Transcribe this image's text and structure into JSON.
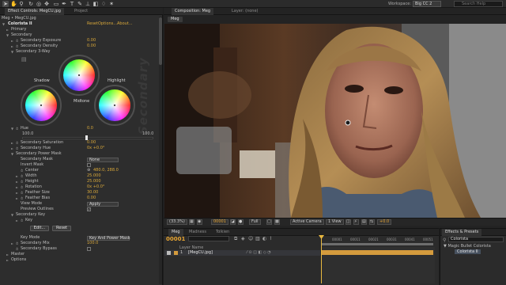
{
  "toolbar": {
    "tools": [
      "selection-tool",
      "hand-tool",
      "zoom-tool",
      "rotation-tool",
      "camera-orbit-tool",
      "pan-behind-tool",
      "rectangle-mask-tool",
      "pen-tool",
      "type-tool",
      "brush-tool",
      "clone-stamp-tool",
      "eraser-tool",
      "roto-brush-tool",
      "puppet-pin-tool"
    ],
    "workspace_label": "Workspace:",
    "workspace_value": "Big CC 2",
    "help_placeholder": "Search Help"
  },
  "effects_panel": {
    "tab_label": "Effect Controls: MegCU.jpg",
    "project_tab": "Project",
    "breadcrumb": "Meg • MegCU.jpg",
    "effect_name": "Colorista II",
    "effect_links": [
      "Reset",
      "Options...",
      "About..."
    ],
    "rows": {
      "primary": "Primary",
      "secondary": "Secondary",
      "sec_exposure": "Secondary Exposure",
      "sec_exposure_val": "0.00",
      "sec_density": "Secondary Density",
      "sec_density_val": "0.00",
      "sec_3way": "Secondary 3-Way",
      "hue": "Hue",
      "hue_val": "0.0",
      "hue_range_min": "100.0",
      "hue_range_max": "100.0",
      "sec_saturation": "Secondary Saturation",
      "sec_saturation_val": "0.00",
      "sec_hue": "Secondary Hue",
      "sec_hue_val": "0x +0.0°",
      "sec_power_mask": "Secondary Power Mask",
      "sec_mask": "Secondary Mask",
      "sec_mask_val": "None",
      "invert_mask": "Invert Mask",
      "center": "Center",
      "center_val": "480.0, 288.0",
      "width": "Width",
      "width_val": "25.000",
      "height": "Height",
      "height_val": "25.000",
      "rotation": "Rotation",
      "rotation_val": "0x +0.0°",
      "feather_size": "Feather Size",
      "feather_size_val": "30.00",
      "feather_bias": "Feather Bias",
      "feather_bias_val": "0.00",
      "view_mode": "View Mode",
      "view_mode_val": "Apply",
      "preview_outlines": "Preview Outlines",
      "sec_key": "Secondary Key",
      "key": "Key",
      "edit_btn": "Edit...",
      "reset_btn": "Reset",
      "key_mode": "Key Mode",
      "key_mode_val": "Key And Power Mask",
      "sec_mix": "Secondary Mix",
      "sec_mix_val": "100.0",
      "sec_bypass": "Secondary Bypass",
      "master": "Master",
      "options": "Options"
    },
    "wheels": {
      "shadow": "Shadow",
      "midtone": "Midtone",
      "highlight": "Highlight"
    },
    "watermark": "Secondary"
  },
  "comp_panel": {
    "tab_label": "Composition: Meg",
    "layer_tab": "Layer: (none)",
    "sub_tab": "Meg",
    "footer": {
      "zoom": "(33.3%)",
      "timecode": "00001",
      "resolution": "Full",
      "camera": "Active Camera",
      "views": "1 View",
      "exposure": "+0.0"
    }
  },
  "timeline": {
    "tabs": [
      "Meg",
      "Madness",
      "Tolkien"
    ],
    "timecode": "00001",
    "ruler": [
      "00001",
      "00011",
      "00021",
      "00031",
      "00041",
      "00051"
    ],
    "column_header": "Layer Name",
    "layer_number": "1",
    "layer_name": "[MegCU.jpg]"
  },
  "presets_panel": {
    "tab_label": "Effects & Presets",
    "search_value": "Colorista",
    "category": "Magic Bullet Colorista",
    "item": "Colorista II"
  },
  "colors": {
    "accent_orange": "#d9a83a",
    "timecode_orange": "#e8a633",
    "layer_bar": "#d49b3d",
    "panel_bg": "#2d2d2d"
  }
}
